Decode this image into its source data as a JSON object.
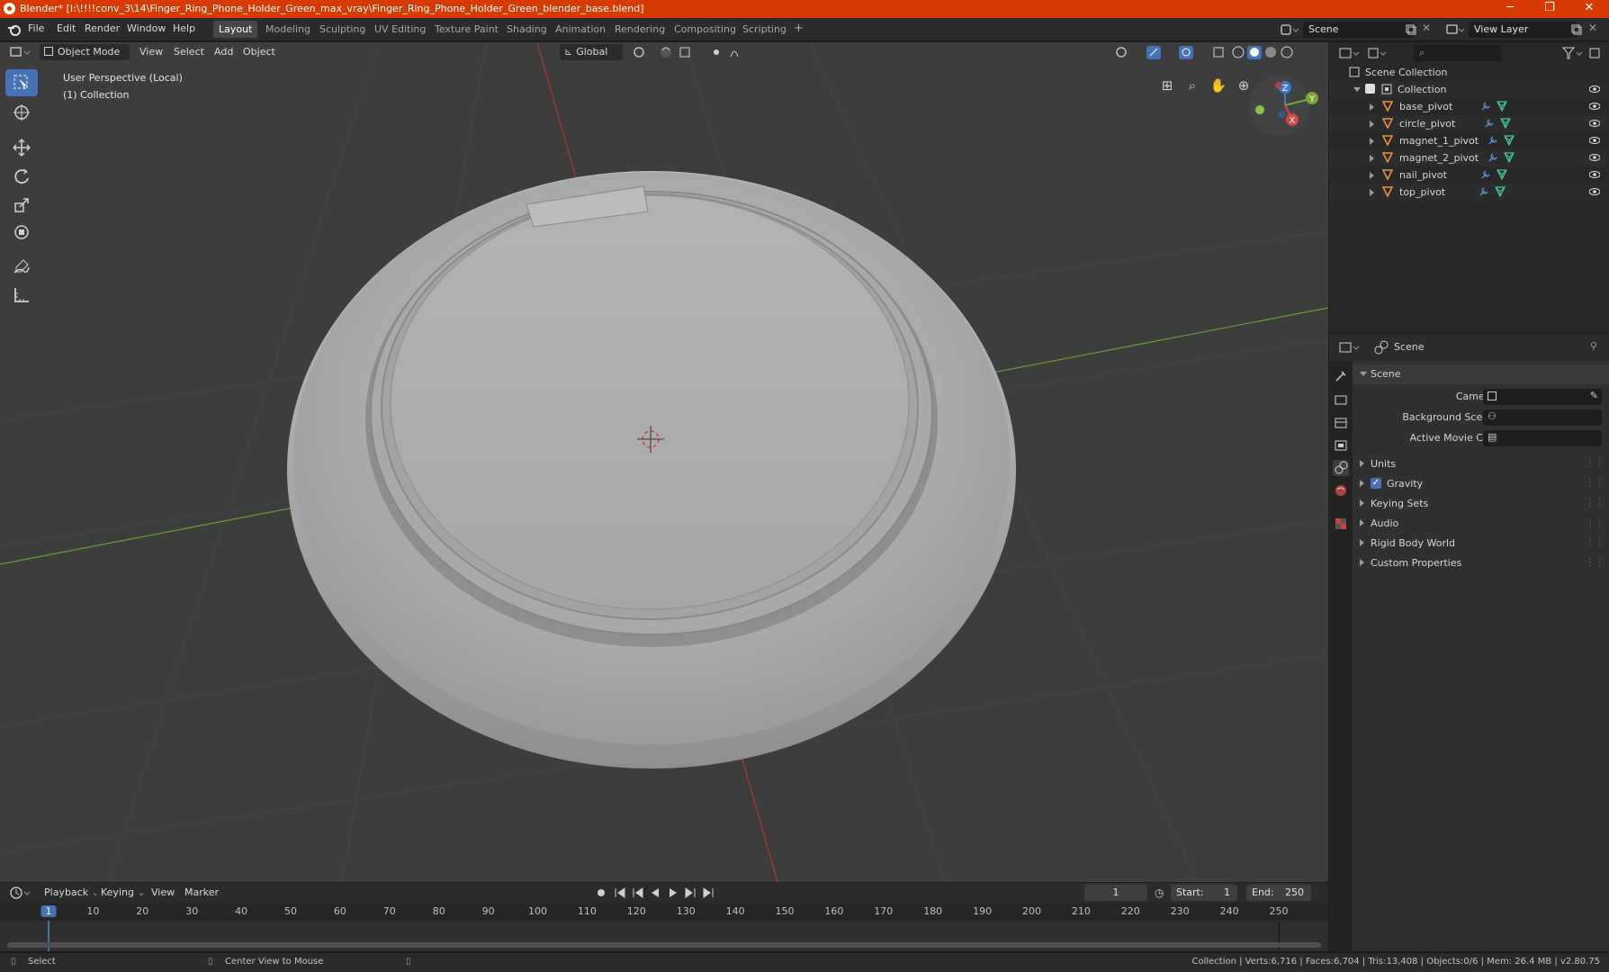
{
  "window": {
    "title": "Blender* [I:\\!!!!conv_3\\14\\Finger_Ring_Phone_Holder_Green_max_vray\\Finger_Ring_Phone_Holder_Green_blender_base.blend]",
    "minimize": "─",
    "maximize": "❐",
    "close": "✕"
  },
  "menus": [
    "File",
    "Edit",
    "Render",
    "Window",
    "Help"
  ],
  "workspaces": [
    "Layout",
    "Modeling",
    "Sculpting",
    "UV Editing",
    "Texture Paint",
    "Shading",
    "Animation",
    "Rendering",
    "Compositing",
    "Scripting"
  ],
  "add_workspace": "+",
  "scene_field": "Scene",
  "view_layer_field": "View Layer",
  "viewport": {
    "mode": "Object Mode",
    "menus": [
      "View",
      "Select",
      "Add",
      "Object"
    ],
    "orientation": "Global",
    "info_line1": "User Perspective (Local)",
    "info_line2": "(1) Collection",
    "gizmo": {
      "x": "X",
      "y": "Y",
      "z": "Z"
    }
  },
  "outliner": {
    "root": "Scene Collection",
    "collection": "Collection",
    "objects": [
      "base_pivot",
      "circle_pivot",
      "magnet_1_pivot",
      "magnet_2_pivot",
      "nail_pivot",
      "top_pivot"
    ]
  },
  "properties": {
    "header": "Scene",
    "panel_title": "Scene",
    "camera_label": "Camera",
    "background_label": "Background Scene",
    "movie_clip_label": "Active Movie Clip",
    "sections": [
      "Units",
      "Gravity",
      "Keying Sets",
      "Audio",
      "Rigid Body World",
      "Custom Properties"
    ],
    "gravity_checked": true
  },
  "timeline": {
    "menus": [
      "Playback",
      "Keying",
      "View",
      "Marker"
    ],
    "current_frame": "1",
    "start_label": "Start:",
    "start_value": "1",
    "end_label": "End:",
    "end_value": "250",
    "ticks": [
      "1",
      "10",
      "20",
      "30",
      "40",
      "50",
      "60",
      "70",
      "80",
      "90",
      "100",
      "110",
      "120",
      "130",
      "140",
      "150",
      "160",
      "170",
      "180",
      "190",
      "200",
      "210",
      "220",
      "230",
      "240",
      "250"
    ]
  },
  "status": {
    "select": "Select",
    "center_view": "Center View to Mouse",
    "stats": "Collection | Verts:6,716 | Faces:6,704 | Tris:13,408 | Objects:0/6 | Mem: 26.4 MB | v2.80.75"
  }
}
